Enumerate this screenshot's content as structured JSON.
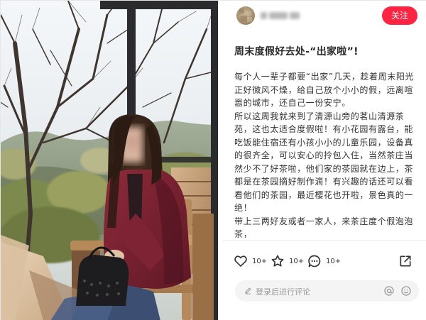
{
  "post": {
    "title": "周末度假好去处-“出家啦”!",
    "paragraphs": [
      "每个人一辈子都要“出家”几天，趁着周末阳光正好微风不燥，给自己放个小小的假，远离喧嚣的城市，还自己一份安宁。",
      "所以这周我就来到了清源山旁的茗山清源茶苑，这也太适合度假啦！有小花园有露台，能吃饭能住宿还有小孩小小的儿童乐园，设备真的很齐全，可以安心的拎包入住，当然茶庄当然少不了好茶啦，他们家的茶园就在边上，茶都是在茶园摘好制作滴！有兴趣的话还可以看看他们的茶园，最近樱花也开啦，景色真的一绝！",
      "带上三两好友或者一家人，来茶庄度个假泡泡茶，"
    ]
  },
  "header": {
    "follow_label": "关注"
  },
  "actions": {
    "like_count": "10+",
    "collect_count": "10+",
    "comment_count": "10+"
  },
  "comment_input": {
    "placeholder": "登录后进行评论"
  },
  "icons": {
    "like": "heart-icon",
    "collect": "star-icon",
    "comment": "chat-bubble-icon",
    "share": "share-icon",
    "pencil": "pencil-icon",
    "mention": "at-icon",
    "emoji": "emoji-icon"
  },
  "colors": {
    "accent": "#ff2442",
    "text": "#333333",
    "placeholder": "#9a9a9a",
    "input_bg": "#f4f4f4"
  }
}
